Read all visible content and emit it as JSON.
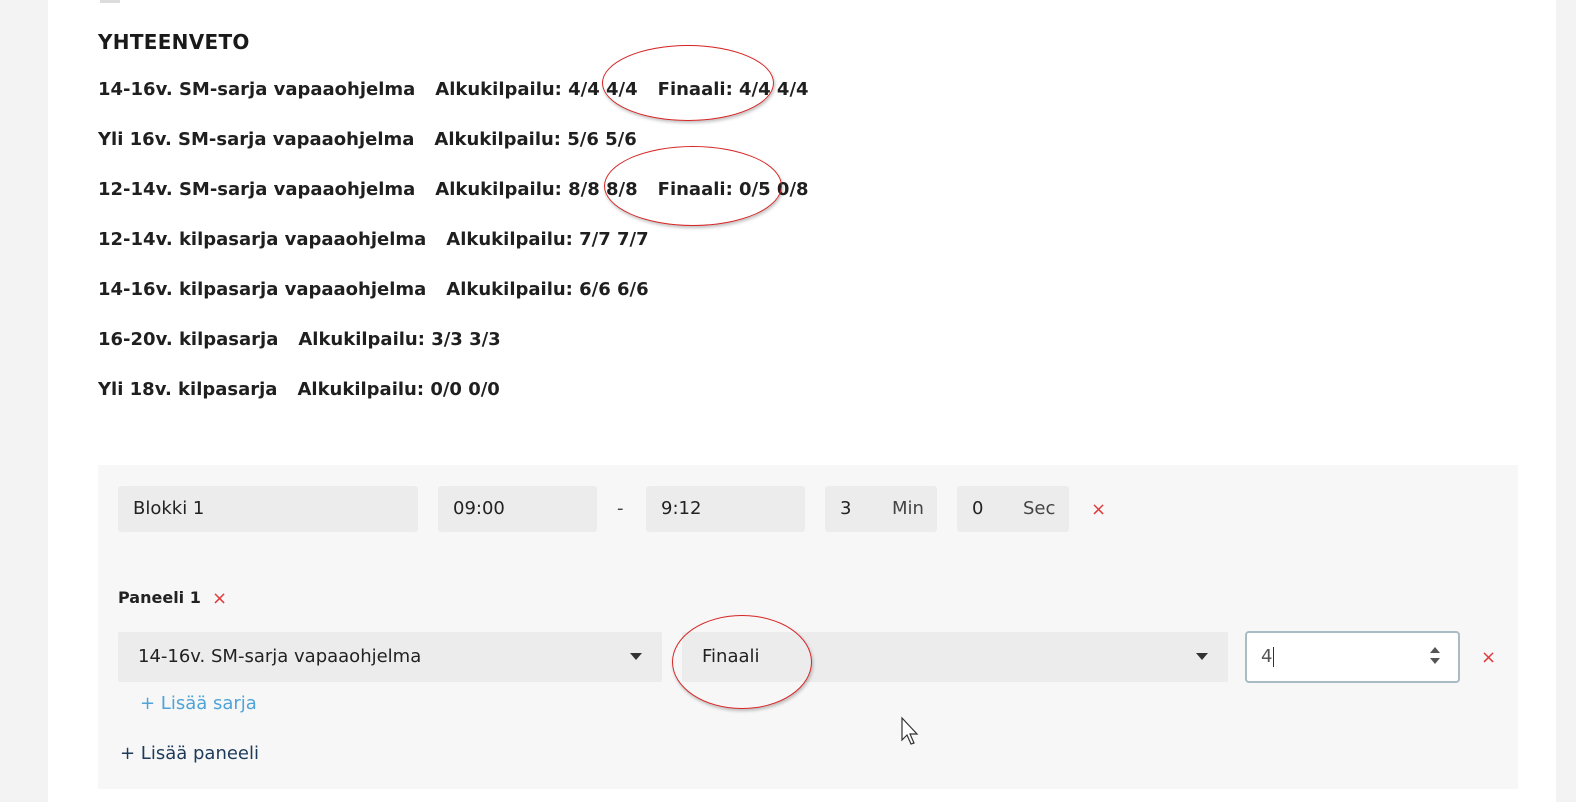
{
  "summary": {
    "title": "YHTEENVETO",
    "rows": [
      {
        "series": "14-16v. SM-sarja vapaaohjelma",
        "prelim": "Alkukilpailu: 4/4 4/4",
        "final": "Finaali: 4/4 4/4"
      },
      {
        "series": "Yli 16v. SM-sarja vapaaohjelma",
        "prelim": "Alkukilpailu: 5/6 5/6",
        "final": ""
      },
      {
        "series": "12-14v. SM-sarja vapaaohjelma",
        "prelim": "Alkukilpailu: 8/8 8/8",
        "final": "Finaali: 0/5 0/8"
      },
      {
        "series": "12-14v. kilpasarja vapaaohjelma",
        "prelim": "Alkukilpailu: 7/7 7/7",
        "final": ""
      },
      {
        "series": "14-16v. kilpasarja vapaaohjelma",
        "prelim": "Alkukilpailu: 6/6 6/6",
        "final": ""
      },
      {
        "series": "16-20v. kilpasarja",
        "prelim": "Alkukilpailu: 3/3 3/3",
        "final": ""
      },
      {
        "series": "Yli 18v. kilpasarja",
        "prelim": "Alkukilpailu: 0/0 0/0",
        "final": ""
      }
    ]
  },
  "block": {
    "name": "Blokki 1",
    "start_time": "09:00",
    "separator": "-",
    "end_time": "9:12",
    "minutes": "3",
    "minutes_unit": "Min",
    "seconds": "0",
    "seconds_unit": "Sec",
    "remove": "×"
  },
  "panel": {
    "label": "Paneeli 1",
    "remove": "×",
    "series_select": "14-16v. SM-sarja vapaaohjelma",
    "round_select": "Finaali",
    "count_value": "4",
    "row_remove": "×",
    "add_series": "+ Lisää sarja",
    "add_panel": "+ Lisää paneeli"
  },
  "colors": {
    "remove_red": "#e03a3a",
    "link_blue": "#4ea3d8",
    "link_navy": "#1e3a5a",
    "annotation_red": "#d62424"
  },
  "icons": {
    "dropdown": "caret-down-icon",
    "stepper": "spinner-icon",
    "pointer": "mouse-cursor-icon"
  }
}
